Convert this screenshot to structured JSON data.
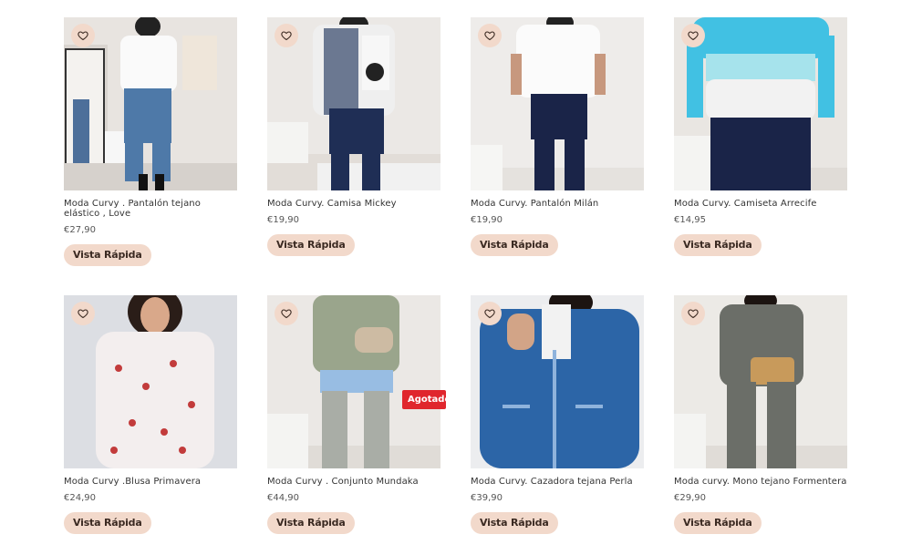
{
  "products": [
    {
      "title": "Moda Curvy . Pantalón tejano elástico , Love",
      "price": "€27,90",
      "quick_view": "Vista Rápida",
      "sold_out": ""
    },
    {
      "title": "Moda Curvy. Camisa Mickey",
      "price": "€19,90",
      "quick_view": "Vista Rápida",
      "sold_out": ""
    },
    {
      "title": "Moda Curvy. Pantalón Milán",
      "price": "€19,90",
      "quick_view": "Vista Rápida",
      "sold_out": ""
    },
    {
      "title": "Moda Curvy. Camiseta Arrecife",
      "price": "€14,95",
      "quick_view": "Vista Rápida",
      "sold_out": ""
    },
    {
      "title": "Moda Curvy .Blusa Primavera",
      "price": "€24,90",
      "quick_view": "Vista Rápida",
      "sold_out": ""
    },
    {
      "title": "Moda Curvy . Conjunto Mundaka",
      "price": "€44,90",
      "quick_view": "Vista Rápida",
      "sold_out": "Agotado"
    },
    {
      "title": "Moda Curvy. Cazadora tejana Perla",
      "price": "€39,90",
      "quick_view": "Vista Rápida",
      "sold_out": ""
    },
    {
      "title": "Moda curvy. Mono tejano Formentera",
      "price": "€29,90",
      "quick_view": "Vista Rápida",
      "sold_out": ""
    }
  ],
  "icons": {
    "wishlist": "heart-icon"
  },
  "colors": {
    "accent": "#f2d9cb",
    "sold_out": "#e0262d"
  }
}
